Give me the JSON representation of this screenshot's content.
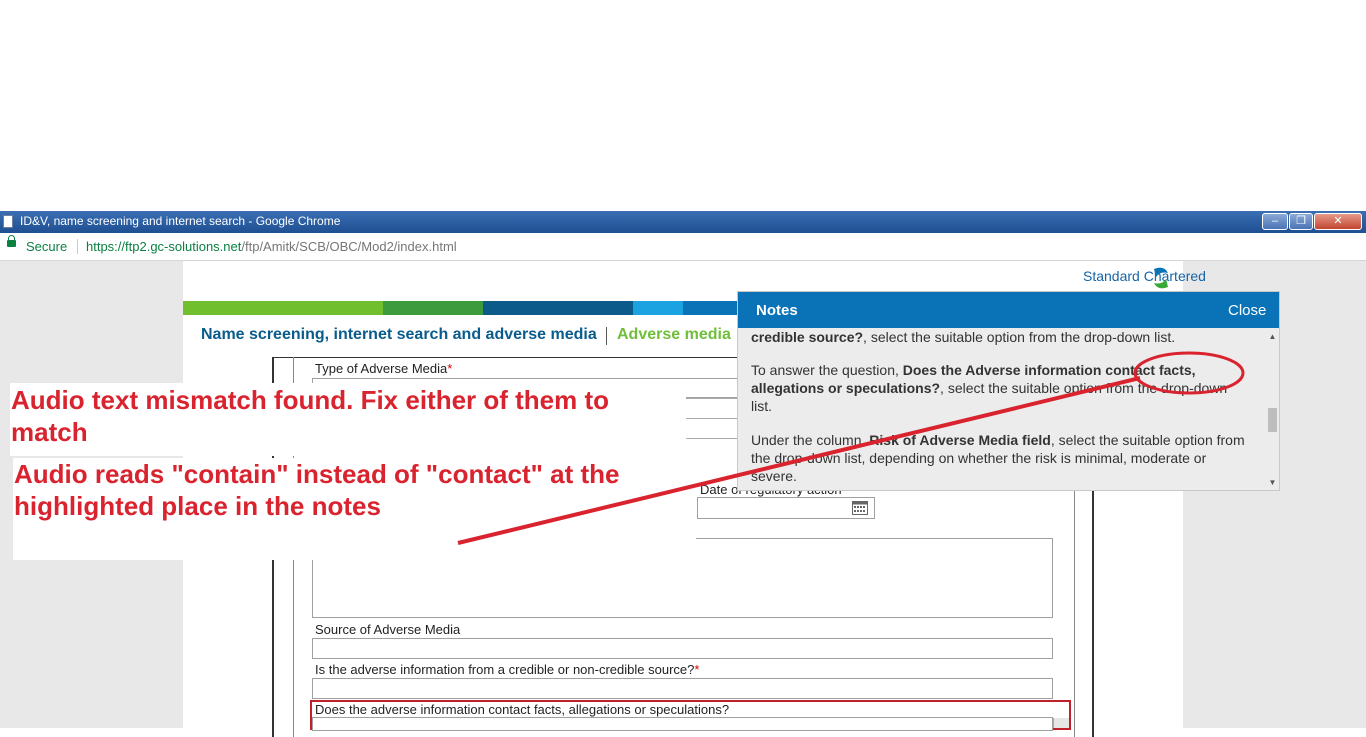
{
  "window": {
    "title": "ID&V, name screening and internet search - Google Chrome"
  },
  "address_bar": {
    "secure_label": "Secure",
    "url_host": "https://ftp2.gc-solutions.net",
    "url_path": "/ftp/Amitk/SCB/OBC/Mod2/index.html"
  },
  "page": {
    "logo_text": "Standard Chartered",
    "breadcrumb_main": "Name screening, internet search and adverse media",
    "breadcrumb_current": "Adverse media"
  },
  "form": {
    "type_label": "Type of Adverse Media",
    "required_mark": "*",
    "date_label": "Date of regulatory action",
    "source_label": "Source of Adverse Media",
    "credible_label": "Is the adverse information from a credible or non-credible source?",
    "facts_label": "Does the adverse information contact facts, allegations or speculations?"
  },
  "notes": {
    "title": "Notes",
    "close_label": "Close",
    "p1_bold": "credible source?",
    "p1_rest": ", select the suitable option from the drop-down list.",
    "p2_intro": "To answer the question, ",
    "p2_bold": "Does the Adverse information contact facts, allegations or speculations?",
    "p2_rest": ", select the suitable option from the drop-down list.",
    "p3_intro": "Under the column, ",
    "p3_bold": "Risk of Adverse Media field",
    "p3_rest": ", select the suitable option from the drop-down list, depending on whether the risk is minimal, moderate or severe."
  },
  "annotation": {
    "line1": "Audio text mismatch found. Fix either of them to match",
    "line2": "Audio reads \"contain\" instead of \"contact\" at the highlighted place in the notes",
    "color": "#d9232e"
  },
  "colors": {
    "brand_blue": "#0a73b8",
    "stripe_green_light": "#6fbf2f",
    "stripe_green_dark": "#3d9a3d",
    "stripe_navy": "#0c5a8a",
    "stripe_cyan": "#1aa3e0"
  }
}
